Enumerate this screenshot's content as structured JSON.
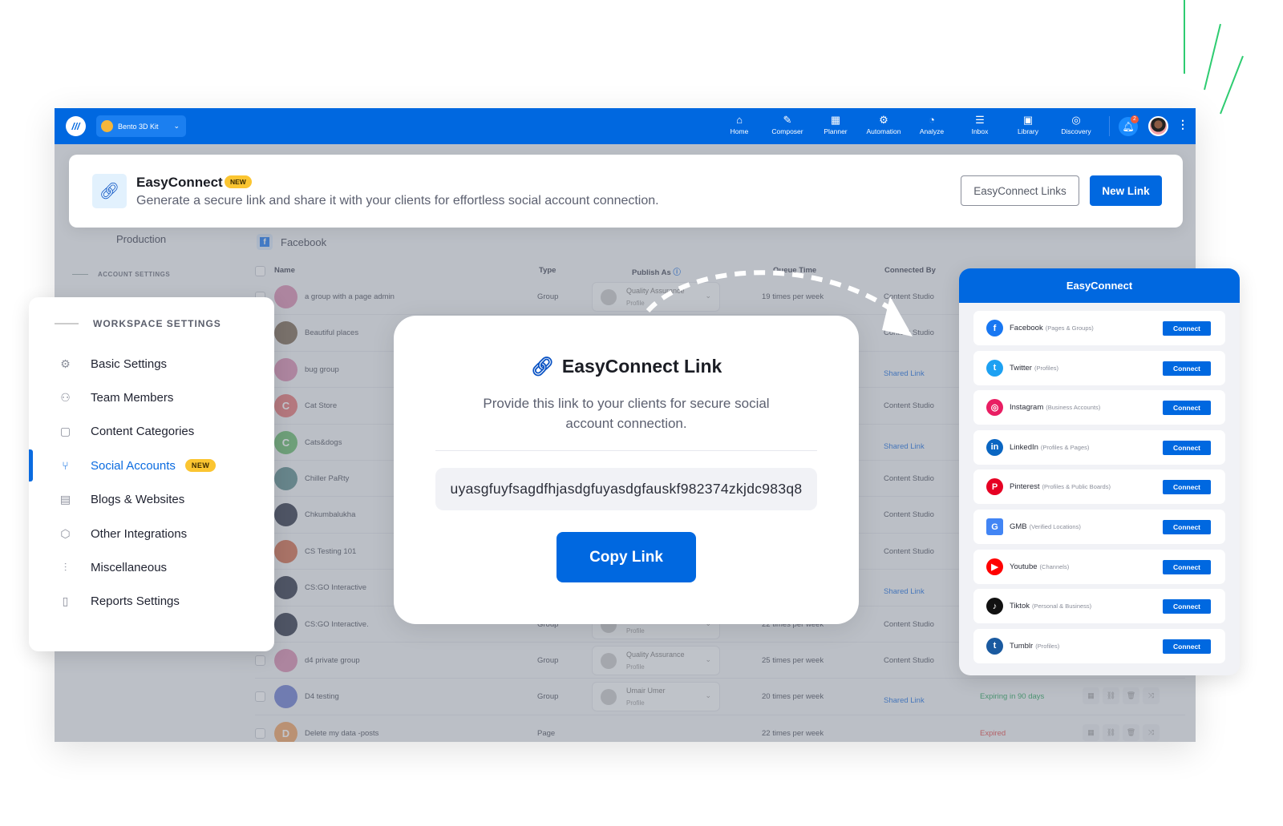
{
  "topbar": {
    "workspace": "Bento 3D Kit",
    "nav": [
      {
        "label": "Home",
        "icon": "home-icon",
        "g": "⌂"
      },
      {
        "label": "Composer",
        "icon": "pencil-icon",
        "g": "✎"
      },
      {
        "label": "Planner",
        "icon": "calendar-icon",
        "g": "▦"
      },
      {
        "label": "Automation",
        "icon": "robot-icon",
        "g": "⚙"
      },
      {
        "label": "Analyze",
        "icon": "pie-chart-icon",
        "g": "◔"
      },
      {
        "label": "Inbox",
        "icon": "chat-icon",
        "g": "☰"
      },
      {
        "label": "Library",
        "icon": "image-icon",
        "g": "▣"
      },
      {
        "label": "Discovery",
        "icon": "compass-icon",
        "g": "◎"
      }
    ],
    "notifications": "2"
  },
  "banner": {
    "title": "EasyConnect",
    "badge": "NEW",
    "subtitle": "Generate a secure link and share it with your clients for effortless social account connection.",
    "links_button": "EasyConnect Links",
    "new_button": "New Link"
  },
  "left": {
    "workspace_name": "Production",
    "account_settings": "ACCOUNT SETTINGS"
  },
  "main": {
    "platform": "Facebook",
    "columns": [
      "Name",
      "Type",
      "Publish As",
      "Queue Time",
      "Connected By"
    ],
    "rows": [
      {
        "name": "a group with a page admin",
        "type": "Group",
        "publish": "Quality Assurance",
        "profile": "Profile",
        "queue": "19 times per week",
        "by": "Content Studio",
        "av": "#d98bb0"
      },
      {
        "name": "Beautiful places",
        "by": "Content Studio",
        "av": "#7a6650"
      },
      {
        "name": "bug group",
        "by": "Shared Link",
        "av": "#d98bb0"
      },
      {
        "name": "Cat Store",
        "by": "Content Studio",
        "av": "#e57373",
        "letter": "C"
      },
      {
        "name": "Cats&dogs",
        "by": "Shared Link",
        "av": "#66bb6a",
        "letter": "C"
      },
      {
        "name": "Chiller PaRty",
        "by": "Content Studio",
        "av": "#5a8a8a"
      },
      {
        "name": "Chkumbalukha",
        "by": "Content Studio",
        "av": "#2e3345"
      },
      {
        "name": "CS Testing 101",
        "by": "Content Studio",
        "av": "#d26a4a"
      },
      {
        "name": "CS:GO Interactive",
        "by": "Shared Link",
        "av": "#2e3345"
      },
      {
        "name": "CS:GO Interactive.",
        "type": "Group",
        "profile": "Profile",
        "queue": "22 times per week",
        "by": "Content Studio",
        "av": "#2e3345"
      },
      {
        "name": "d4 private group",
        "type": "Group",
        "publish": "Quality Assurance",
        "profile": "Profile",
        "queue": "25 times per week",
        "by": "Content Studio",
        "av": "#d98bb0"
      },
      {
        "name": "D4 testing",
        "type": "Group",
        "publish": "Umair Umer",
        "profile": "Profile",
        "queue": "20 times per week",
        "by": "Shared Link",
        "status": "Expiring in 90 days",
        "st": "ok",
        "av": "#6a7ad0"
      },
      {
        "name": "Delete my data -posts",
        "type": "Page",
        "queue": "22 times per week",
        "status": "Expired",
        "st": "bad",
        "av": "#f0a060",
        "letter": "D"
      }
    ]
  },
  "workspace_settings": {
    "heading": "WORKSPACE SETTINGS",
    "items": [
      {
        "label": "Basic Settings",
        "icon": "gear-icon",
        "g": "⚙"
      },
      {
        "label": "Team Members",
        "icon": "users-icon",
        "g": "⚇"
      },
      {
        "label": "Content Categories",
        "icon": "categories-icon",
        "g": "▢"
      },
      {
        "label": "Social Accounts",
        "icon": "branch-icon",
        "g": "⑂",
        "active": true,
        "badge": "NEW"
      },
      {
        "label": "Blogs & Websites",
        "icon": "layout-icon",
        "g": "▤"
      },
      {
        "label": "Other Integrations",
        "icon": "hexagon-icon",
        "g": "⬡"
      },
      {
        "label": "Miscellaneous",
        "icon": "sliders-icon",
        "g": "⫶"
      },
      {
        "label": "Reports Settings",
        "icon": "document-icon",
        "g": "▯"
      }
    ]
  },
  "modal": {
    "title": "EasyConnect Link",
    "subtitle": "Provide this link to your clients for secure social account connection.",
    "link": "uyasgfuyfsagdfhjasdgfuyasdgfauskf982374zkjdc983q8",
    "copy_button": "Copy Link"
  },
  "easyconnect": {
    "title": "EasyConnect",
    "connect": "Connect",
    "platforms": [
      {
        "name": "Facebook",
        "desc": "(Pages & Groups)",
        "color": "#1877f2",
        "g": "f",
        "icon": "facebook-icon"
      },
      {
        "name": "Twitter",
        "desc": "(Profiles)",
        "color": "#1da1f2",
        "g": "t",
        "icon": "twitter-icon"
      },
      {
        "name": "Instagram",
        "desc": "(Business Accounts)",
        "color": "#e91e63",
        "g": "◎",
        "icon": "instagram-icon"
      },
      {
        "name": "LinkedIn",
        "desc": "(Profiles & Pages)",
        "color": "#0a66c2",
        "g": "in",
        "icon": "linkedin-icon"
      },
      {
        "name": "Pinterest",
        "desc": "(Profiles & Public Boards)",
        "color": "#e60023",
        "g": "P",
        "icon": "pinterest-icon"
      },
      {
        "name": "GMB",
        "desc": "(Verified Locations)",
        "color": "#4285f4",
        "g": "G",
        "icon": "gmb-icon"
      },
      {
        "name": "Youtube",
        "desc": "(Channels)",
        "color": "#ff0000",
        "g": "▶",
        "icon": "youtube-icon"
      },
      {
        "name": "Tiktok",
        "desc": "(Personal & Business)",
        "color": "#111111",
        "g": "♪",
        "icon": "tiktok-icon"
      },
      {
        "name": "Tumblr",
        "desc": "(Profiles)",
        "color": "#1a5aa0",
        "g": "t",
        "icon": "tumblr-icon"
      }
    ]
  },
  "colors": {
    "brand": "#0068e0",
    "badge": "#fbc531",
    "decor": "#2ecc71"
  }
}
